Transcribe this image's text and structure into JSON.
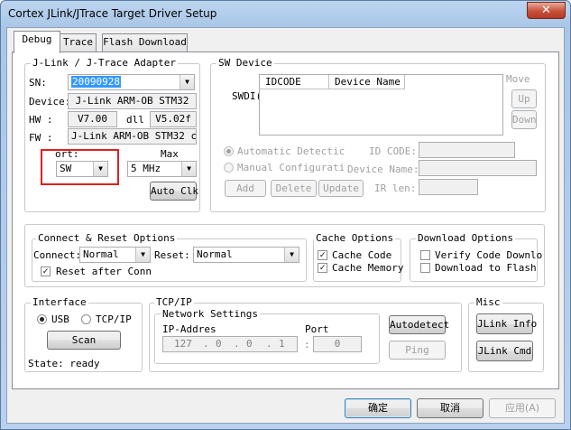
{
  "window": {
    "title": "Cortex JLink/JTrace Target Driver Setup",
    "close_glyph": "✕"
  },
  "tabs": [
    {
      "label": "Debug"
    },
    {
      "label": "Trace"
    },
    {
      "label": "Flash Download"
    }
  ],
  "adapter": {
    "group_label": "J-Link / J-Trace Adapter",
    "sn_label": "SN:",
    "sn_value": "20090928",
    "device_label": "Device:",
    "device_value": "J-Link ARM-OB STM32",
    "hw_label": "HW :",
    "hw_value": "V7.00",
    "dll_label": "dll",
    "dll_value": "V5.02f",
    "fw_label": "FW :",
    "fw_value": "J-Link ARM-OB STM32 comp",
    "port_label": "ort:",
    "port_value": "SW",
    "max_label": "Max",
    "max_value": "5 MHz",
    "auto_clk_label": "Auto Clk"
  },
  "sw_device": {
    "group_label": "SW Device",
    "swdio_label": "SWDI(",
    "columns": [
      "IDCODE",
      "Device Name"
    ],
    "move_label": "Move",
    "up_label": "Up",
    "down_label": "Down",
    "auto_detect_label": "Automatic Detectic",
    "manual_config_label": "Manual Configurati",
    "id_code_label": "ID CODE:",
    "device_name_label": "Device Name:",
    "ir_len_label": "IR len:",
    "add_label": "Add",
    "delete_label": "Delete",
    "update_label": "Update"
  },
  "connect": {
    "group_label": "Connect & Reset Options",
    "connect_label": "Connect:",
    "connect_value": "Normal",
    "reset_label": "Reset:",
    "reset_value": "Normal",
    "reset_after_conn_label": "Reset after Conn",
    "reset_after_conn_checked": true
  },
  "cache": {
    "group_label": "Cache Options",
    "cache_code_label": "Cache Code",
    "cache_code_checked": true,
    "cache_memory_label": "Cache Memory",
    "cache_memory_checked": true
  },
  "download": {
    "group_label": "Download Options",
    "verify_label": "Verify Code Downlo",
    "verify_checked": false,
    "flash_label": "Download to Flash",
    "flash_checked": false
  },
  "interface": {
    "group_label": "Interface",
    "usb_label": "USB",
    "tcpip_label": "TCP/IP",
    "selected": "USB",
    "scan_label": "Scan",
    "state_label": "State: ready"
  },
  "tcpip": {
    "group_label": "TCP/IP",
    "network_label": "Network Settings",
    "ip_label": "IP-Addres",
    "ip_octets": [
      "127",
      "0",
      "0",
      "1"
    ],
    "port_label": "Port",
    "port_value": "0",
    "autodetect_label": "Autodetect",
    "ping_label": "Ping"
  },
  "misc": {
    "group_label": "Misc",
    "jlink_info_label": "JLink Info",
    "jlink_cmd_label": "JLink Cmd"
  },
  "footer": {
    "ok_label": "确定",
    "cancel_label": "取消",
    "apply_label": "应用(A)"
  },
  "colors": {
    "highlight_box": "#e02020",
    "selection": "#3399ff",
    "close_button": "#c7503a"
  }
}
